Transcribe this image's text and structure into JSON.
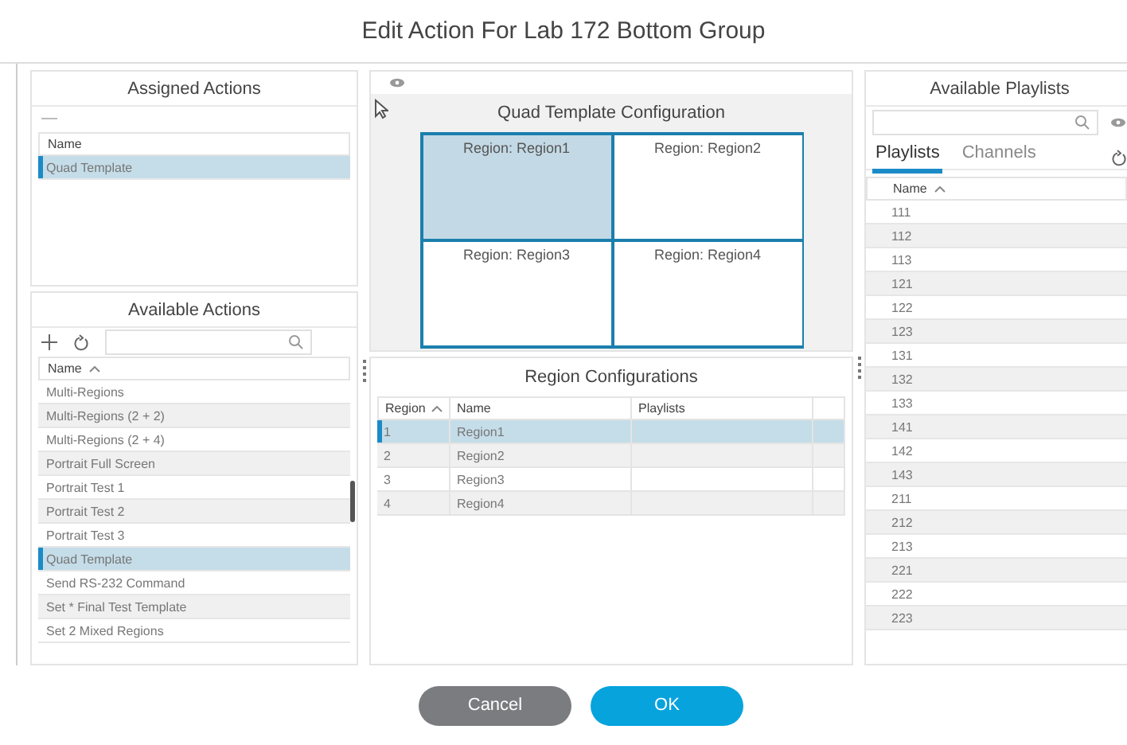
{
  "window": {
    "title": "Edit Action For Lab 172 Bottom Group"
  },
  "assigned_actions": {
    "title": "Assigned Actions",
    "column": "Name",
    "rows": [
      {
        "name": "Quad Template",
        "selected": true
      }
    ]
  },
  "available_actions": {
    "title": "Available Actions",
    "column": "Name",
    "rows": [
      {
        "name": "Multi-Regions",
        "selected": false
      },
      {
        "name": "Multi-Regions (2 + 2)",
        "selected": false
      },
      {
        "name": "Multi-Regions (2 + 4)",
        "selected": false
      },
      {
        "name": "Portrait Full Screen",
        "selected": false
      },
      {
        "name": "Portrait Test 1",
        "selected": false
      },
      {
        "name": "Portrait Test 2",
        "selected": false
      },
      {
        "name": "Portrait Test 3",
        "selected": false
      },
      {
        "name": "Quad Template",
        "selected": true
      },
      {
        "name": "Send RS-232 Command",
        "selected": false
      },
      {
        "name": "Set * Final Test Template",
        "selected": false
      },
      {
        "name": "Set 2 Mixed Regions",
        "selected": false
      }
    ]
  },
  "template_preview": {
    "title": "Quad Template Configuration",
    "regions": [
      {
        "label": "Region: Region1",
        "selected": true
      },
      {
        "label": "Region: Region2",
        "selected": false
      },
      {
        "label": "Region: Region3",
        "selected": false
      },
      {
        "label": "Region: Region4",
        "selected": false
      }
    ]
  },
  "region_configurations": {
    "title": "Region Configurations",
    "columns": [
      "Region",
      "Name",
      "Playlists"
    ],
    "rows": [
      {
        "region": "1",
        "name": "Region1",
        "selected": true
      },
      {
        "region": "2",
        "name": "Region2",
        "selected": false
      },
      {
        "region": "3",
        "name": "Region3",
        "selected": false
      },
      {
        "region": "4",
        "name": "Region4",
        "selected": false
      }
    ]
  },
  "available_playlists": {
    "title": "Available Playlists",
    "tabs": [
      {
        "label": "Playlists",
        "selected": true
      },
      {
        "label": "Channels",
        "selected": false
      }
    ],
    "column": "Name",
    "rows": [
      "111",
      "112",
      "113",
      "121",
      "122",
      "123",
      "131",
      "132",
      "133",
      "141",
      "142",
      "143",
      "211",
      "212",
      "213",
      "221",
      "222",
      "223"
    ]
  },
  "buttons": [
    {
      "label": "Cancel",
      "kind": "secondary"
    },
    {
      "label": "OK",
      "kind": "primary"
    }
  ]
}
